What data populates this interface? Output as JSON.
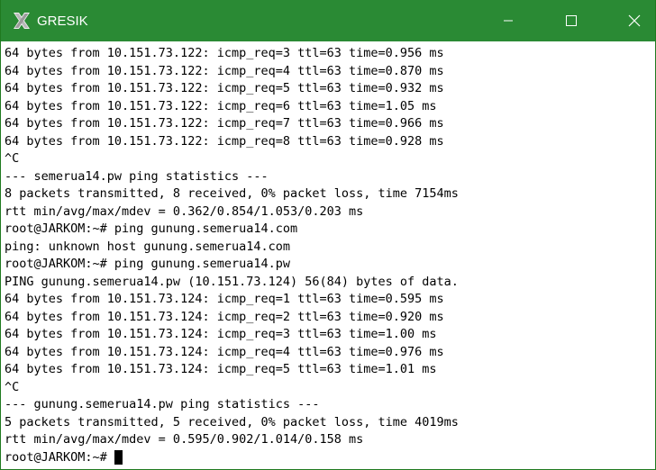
{
  "window": {
    "title": "GRESIK",
    "controls": {
      "minimize": "minimize-icon",
      "maximize": "maximize-icon",
      "close": "close-icon"
    },
    "titlebar_color": "#2a8a34"
  },
  "terminal": {
    "lines": [
      "64 bytes from 10.151.73.122: icmp_req=3 ttl=63 time=0.956 ms",
      "64 bytes from 10.151.73.122: icmp_req=4 ttl=63 time=0.870 ms",
      "64 bytes from 10.151.73.122: icmp_req=5 ttl=63 time=0.932 ms",
      "64 bytes from 10.151.73.122: icmp_req=6 ttl=63 time=1.05 ms",
      "64 bytes from 10.151.73.122: icmp_req=7 ttl=63 time=0.966 ms",
      "64 bytes from 10.151.73.122: icmp_req=8 ttl=63 time=0.928 ms",
      "^C",
      "--- semerua14.pw ping statistics ---",
      "8 packets transmitted, 8 received, 0% packet loss, time 7154ms",
      "rtt min/avg/max/mdev = 0.362/0.854/1.053/0.203 ms",
      "root@JARKOM:~# ping gunung.semerua14.com",
      "ping: unknown host gunung.semerua14.com",
      "root@JARKOM:~# ping gunung.semerua14.pw",
      "PING gunung.semerua14.pw (10.151.73.124) 56(84) bytes of data.",
      "64 bytes from 10.151.73.124: icmp_req=1 ttl=63 time=0.595 ms",
      "64 bytes from 10.151.73.124: icmp_req=2 ttl=63 time=0.920 ms",
      "64 bytes from 10.151.73.124: icmp_req=3 ttl=63 time=1.00 ms",
      "64 bytes from 10.151.73.124: icmp_req=4 ttl=63 time=0.976 ms",
      "64 bytes from 10.151.73.124: icmp_req=5 ttl=63 time=1.01 ms",
      "^C",
      "--- gunung.semerua14.pw ping statistics ---",
      "5 packets transmitted, 5 received, 0% packet loss, time 4019ms",
      "rtt min/avg/max/mdev = 0.595/0.902/1.014/0.158 ms"
    ],
    "prompt": "root@JARKOM:~#"
  }
}
